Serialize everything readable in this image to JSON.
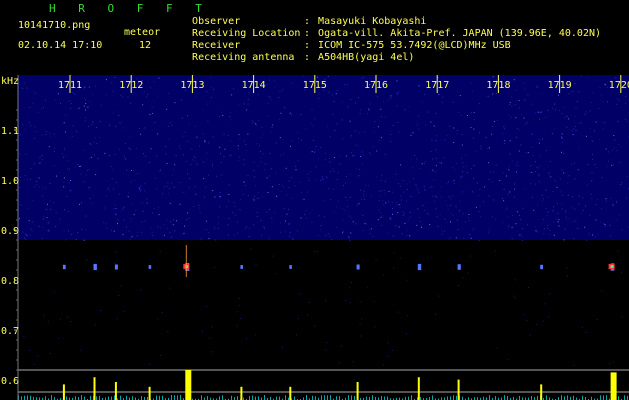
{
  "header": {
    "station": "H R O F F T",
    "filename": "10141710.png",
    "datetime": "02.10.14 17:10",
    "meteor_label": "meteor",
    "meteor_count": "12"
  },
  "info": [
    {
      "key": "Observer",
      "value": "Masayuki Kobayashi"
    },
    {
      "key": "Receiving Location",
      "value": "Ogata-vill. Akita-Pref. JAPAN (139.96E, 40.02N)"
    },
    {
      "key": "Receiver",
      "value": "ICOM IC-575 53.7492(@LCD)MHz USB"
    },
    {
      "key": "Receiving antenna",
      "value": "A504HB(yagi 4el)"
    }
  ],
  "colors": {
    "background": "#000000",
    "spectrogram_base": "#000066",
    "noise_dot": "#3333cc",
    "meteor_line": "#5577ff",
    "tick_text": "#ffff55",
    "title_green": "#33dd33",
    "counter_bar": "#ffff00",
    "counter_noise": "#00aaaa"
  },
  "chart_data": {
    "type": "heatmap",
    "ylabel": "kHz",
    "time_ticks": [
      "1711",
      "1712",
      "1713",
      "1714",
      "1715",
      "1716",
      "1717",
      "1718",
      "1719",
      "1720"
    ],
    "freq_ticks": [
      "1.1",
      "1.0",
      "0.9",
      "0.8",
      "0.7",
      "0.6"
    ],
    "freq_tick_values": [
      1.1,
      1.0,
      0.9,
      0.8,
      0.7,
      0.6
    ],
    "ylim": [
      0.57,
      1.2
    ],
    "xlim": [
      1710.4,
      1720.0
    ],
    "echo_frequency": 0.826,
    "meteors": [
      {
        "t": 1710.9,
        "strength": 0.4
      },
      {
        "t": 1711.4,
        "strength": 0.7
      },
      {
        "t": 1711.75,
        "strength": 0.5
      },
      {
        "t": 1712.3,
        "strength": 0.3
      },
      {
        "t": 1712.9,
        "strength": 1.0
      },
      {
        "t": 1713.8,
        "strength": 0.3
      },
      {
        "t": 1714.6,
        "strength": 0.3
      },
      {
        "t": 1715.7,
        "strength": 0.5
      },
      {
        "t": 1716.7,
        "strength": 0.7
      },
      {
        "t": 1717.35,
        "strength": 0.6
      },
      {
        "t": 1718.7,
        "strength": 0.4
      },
      {
        "t": 1719.85,
        "strength": 0.9
      }
    ]
  }
}
